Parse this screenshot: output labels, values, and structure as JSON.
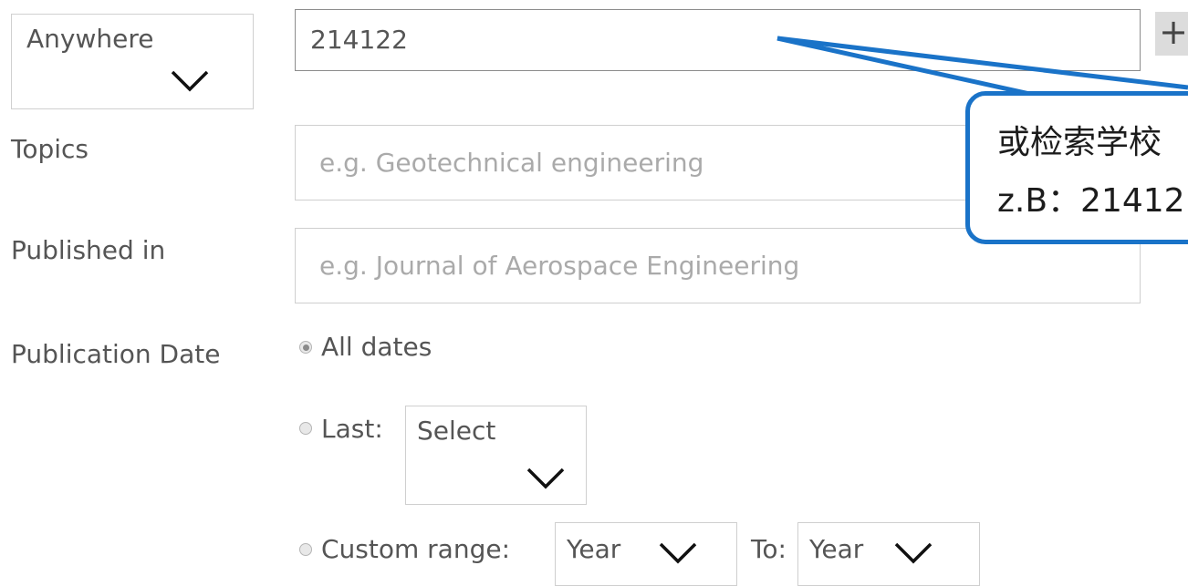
{
  "scope_select": {
    "selected": "Anywhere"
  },
  "search": {
    "value": "214122",
    "add_label": "+"
  },
  "topics": {
    "label": "Topics",
    "placeholder": "e.g. Geotechnical engineering"
  },
  "published_in": {
    "label": "Published in",
    "placeholder": "e.g. Journal of Aerospace Engineering"
  },
  "publication_date": {
    "label": "Publication Date",
    "options": {
      "all": {
        "label": "All dates",
        "checked": true
      },
      "last": {
        "label": "Last:",
        "select_value": "Select"
      },
      "custom": {
        "label": "Custom range:",
        "from_value": "Year",
        "to_label": "To:",
        "to_value": "Year"
      }
    }
  },
  "callout": {
    "line1": "或检索学校",
    "line2": "z.B：21412",
    "color": "#1a73c8"
  }
}
